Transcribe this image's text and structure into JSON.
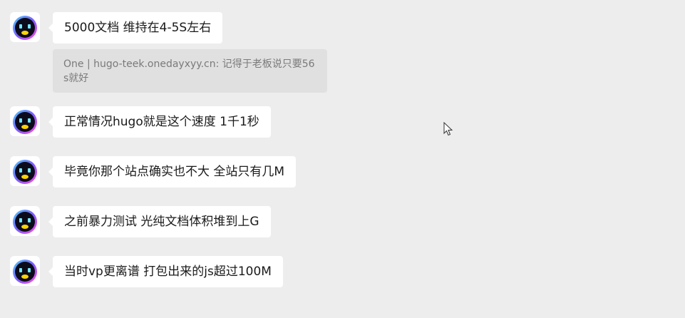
{
  "messages": [
    {
      "text": "5000文档 维持在4-5S左右",
      "quote": "One | hugo-teek.onedayxyy.cn: 记得于老板说只要56s就好"
    },
    {
      "text": "正常情况hugo就是这个速度 1千1秒"
    },
    {
      "text": "毕竟你那个站点确实也不大 全站只有几M"
    },
    {
      "text": "之前暴力测试 光纯文档体积堆到上G"
    },
    {
      "text": "当时vp更离谱 打包出来的js超过100M"
    }
  ],
  "icons": {
    "avatar": "robot-avatar-icon",
    "cursor": "mouse-pointer-icon"
  },
  "colors": {
    "background": "#ededed",
    "bubble": "#ffffff",
    "quote_bg": "#e0e0e0",
    "quote_text": "#7a7a7a",
    "text": "#1a1a1a"
  }
}
